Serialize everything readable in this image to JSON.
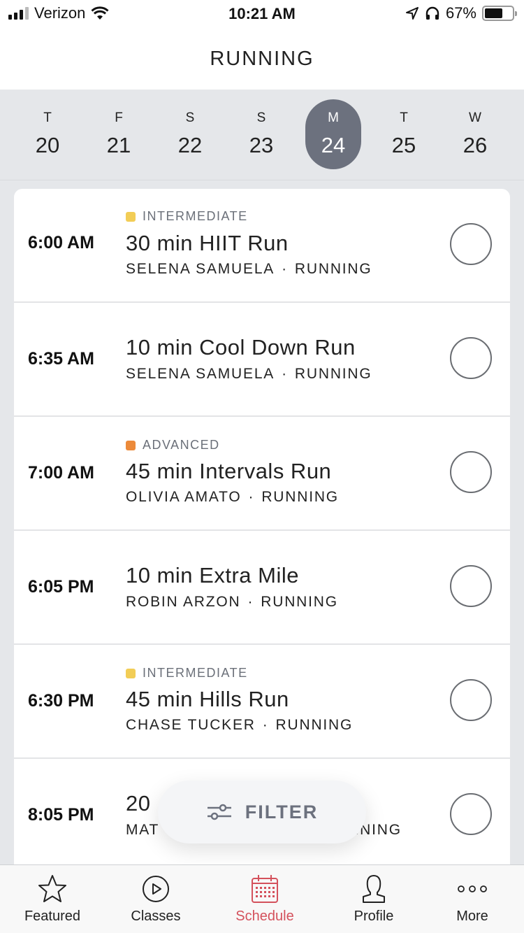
{
  "status_bar": {
    "carrier": "Verizon",
    "time": "10:21 AM",
    "battery": "67%",
    "battery_level": 0.67
  },
  "header": {
    "title": "RUNNING"
  },
  "week": {
    "days": [
      {
        "dow": "T",
        "date": "20",
        "selected": false
      },
      {
        "dow": "F",
        "date": "21",
        "selected": false
      },
      {
        "dow": "S",
        "date": "22",
        "selected": false
      },
      {
        "dow": "S",
        "date": "23",
        "selected": false
      },
      {
        "dow": "M",
        "date": "24",
        "selected": true
      },
      {
        "dow": "T",
        "date": "25",
        "selected": false
      },
      {
        "dow": "W",
        "date": "26",
        "selected": false
      }
    ]
  },
  "colors": {
    "intermediate": "#f2cd56",
    "advanced": "#ec8a3a",
    "accent": "#d4515c",
    "selected_day": "#6c717e"
  },
  "classes": [
    {
      "time": "6:00 AM",
      "level": "INTERMEDIATE",
      "level_color": "#f2cd56",
      "title": "30 min HIIT Run",
      "instructor": "SELENA SAMUELA",
      "category": "RUNNING"
    },
    {
      "time": "6:35 AM",
      "level": "",
      "level_color": "",
      "title": "10 min Cool Down Run",
      "instructor": "SELENA SAMUELA",
      "category": "RUNNING"
    },
    {
      "time": "7:00 AM",
      "level": "ADVANCED",
      "level_color": "#ec8a3a",
      "title": "45 min Intervals Run",
      "instructor": "OLIVIA AMATO",
      "category": "RUNNING"
    },
    {
      "time": "6:05 PM",
      "level": "",
      "level_color": "",
      "title": "10 min Extra Mile",
      "instructor": "ROBIN ARZON",
      "category": "RUNNING"
    },
    {
      "time": "6:30 PM",
      "level": "INTERMEDIATE",
      "level_color": "#f2cd56",
      "title": "45 min Hills Run",
      "instructor": "CHASE TUCKER",
      "category": "RUNNING"
    },
    {
      "time": "8:05 PM",
      "level": "",
      "level_color": "",
      "title": "20",
      "instructor": "MAT",
      "category": "NNING"
    }
  ],
  "separator": "·",
  "filter": {
    "label": "FILTER"
  },
  "tabbar": {
    "tabs": [
      {
        "label": "Featured",
        "icon": "star-icon",
        "active": false
      },
      {
        "label": "Classes",
        "icon": "play-circle-icon",
        "active": false
      },
      {
        "label": "Schedule",
        "icon": "calendar-icon",
        "active": true
      },
      {
        "label": "Profile",
        "icon": "person-icon",
        "active": false
      },
      {
        "label": "More",
        "icon": "more-icon",
        "active": false
      }
    ]
  }
}
